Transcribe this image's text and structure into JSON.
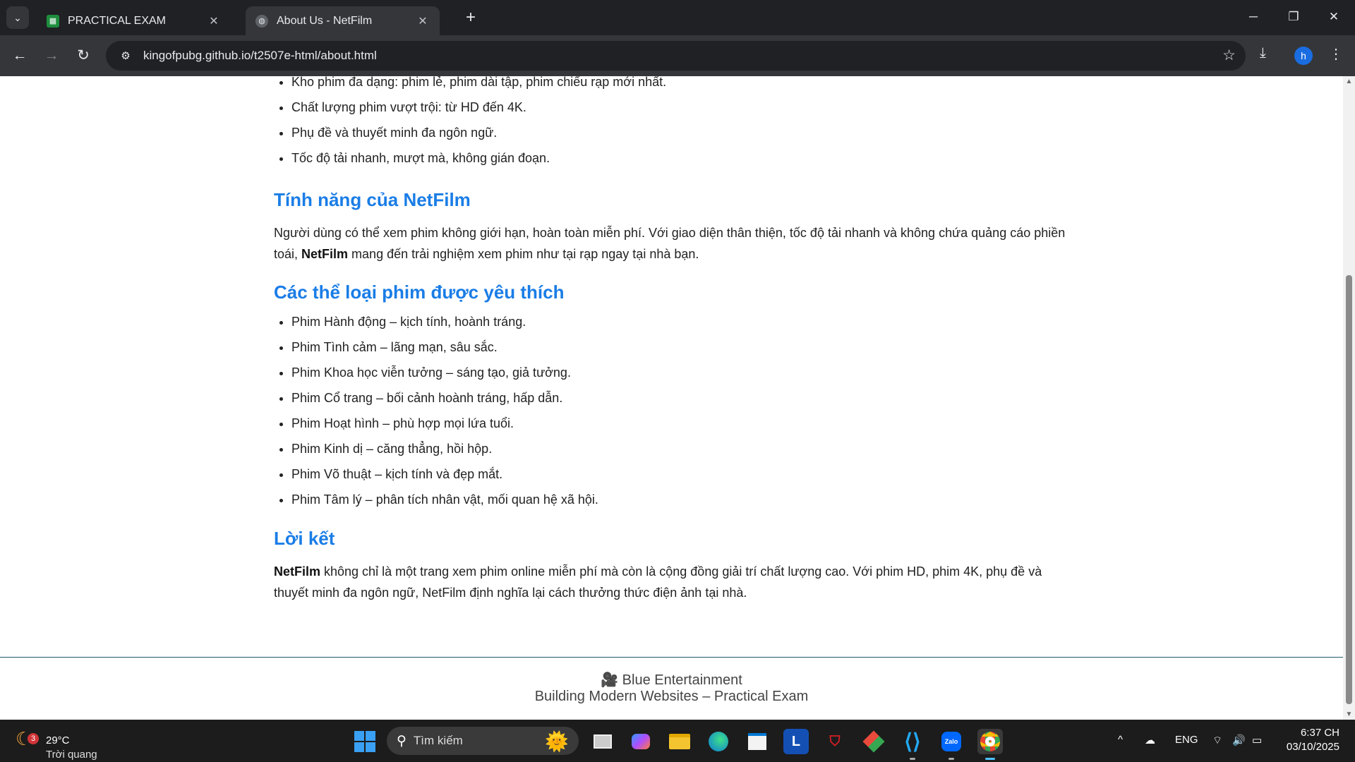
{
  "browser": {
    "tabs": [
      {
        "title": "PRACTICAL EXAM",
        "favicon": "sheets-icon"
      },
      {
        "title": "About Us - NetFilm",
        "favicon": "globe-icon"
      }
    ],
    "url": "kingofpubg.github.io/t2507e-html/about.html",
    "profile_initial": "h"
  },
  "page": {
    "partial_top_item": "Kho phim đa dạng: phim lẻ, phim dài tập, phim chiếu rạp mới nhất.",
    "quality_list": [
      "Chất lượng phim vượt trội: từ HD đến 4K.",
      "Phụ đề và thuyết minh đa ngôn ngữ.",
      "Tốc độ tải nhanh, mượt mà, không gián đoạn."
    ],
    "features": {
      "heading": "Tính năng của NetFilm",
      "text_before": "Người dùng có thể xem phim không giới hạn, hoàn toàn miễn phí. Với giao diện thân thiện, tốc độ tải nhanh và không chứa quảng cáo phiền toái, ",
      "brand": "NetFilm",
      "text_after": " mang đến trải nghiệm xem phim như tại rạp ngay tại nhà bạn."
    },
    "genres": {
      "heading": "Các thể loại phim được yêu thích",
      "items": [
        "Phim Hành động – kịch tính, hoành tráng.",
        "Phim Tình cảm – lãng mạn, sâu sắc.",
        "Phim Khoa học viễn tưởng – sáng tạo, giả tưởng.",
        "Phim Cổ trang – bối cảnh hoành tráng, hấp dẫn.",
        "Phim Hoạt hình – phù hợp mọi lứa tuổi.",
        "Phim Kinh dị – căng thẳng, hồi hộp.",
        "Phim Võ thuật – kịch tính và đẹp mắt.",
        "Phim Tâm lý – phân tích nhân vật, mối quan hệ xã hội."
      ]
    },
    "conclusion": {
      "heading": "Lời kết",
      "brand": "NetFilm",
      "text": " không chỉ là một trang xem phim online miễn phí mà còn là cộng đồng giải trí chất lượng cao. Với phim HD, phim 4K, phụ đề và thuyết minh đa ngôn ngữ, NetFilm định nghĩa lại cách thưởng thức điện ảnh tại nhà."
    },
    "footer": {
      "icon": "🎥",
      "line1": "Blue Entertainment",
      "line2": "Building Modern Websites – Practical Exam"
    }
  },
  "taskbar": {
    "weather_badge": "3",
    "temperature": "29°C",
    "condition": "Trời quang",
    "search_placeholder": "Tìm kiếm",
    "language": "ENG",
    "time": "6:37 CH",
    "date": "03/10/2025"
  },
  "colors": {
    "heading": "#1a7de6",
    "browser_frame": "#202124",
    "toolbar": "#35363a",
    "taskbar": "#1c1c1c"
  }
}
